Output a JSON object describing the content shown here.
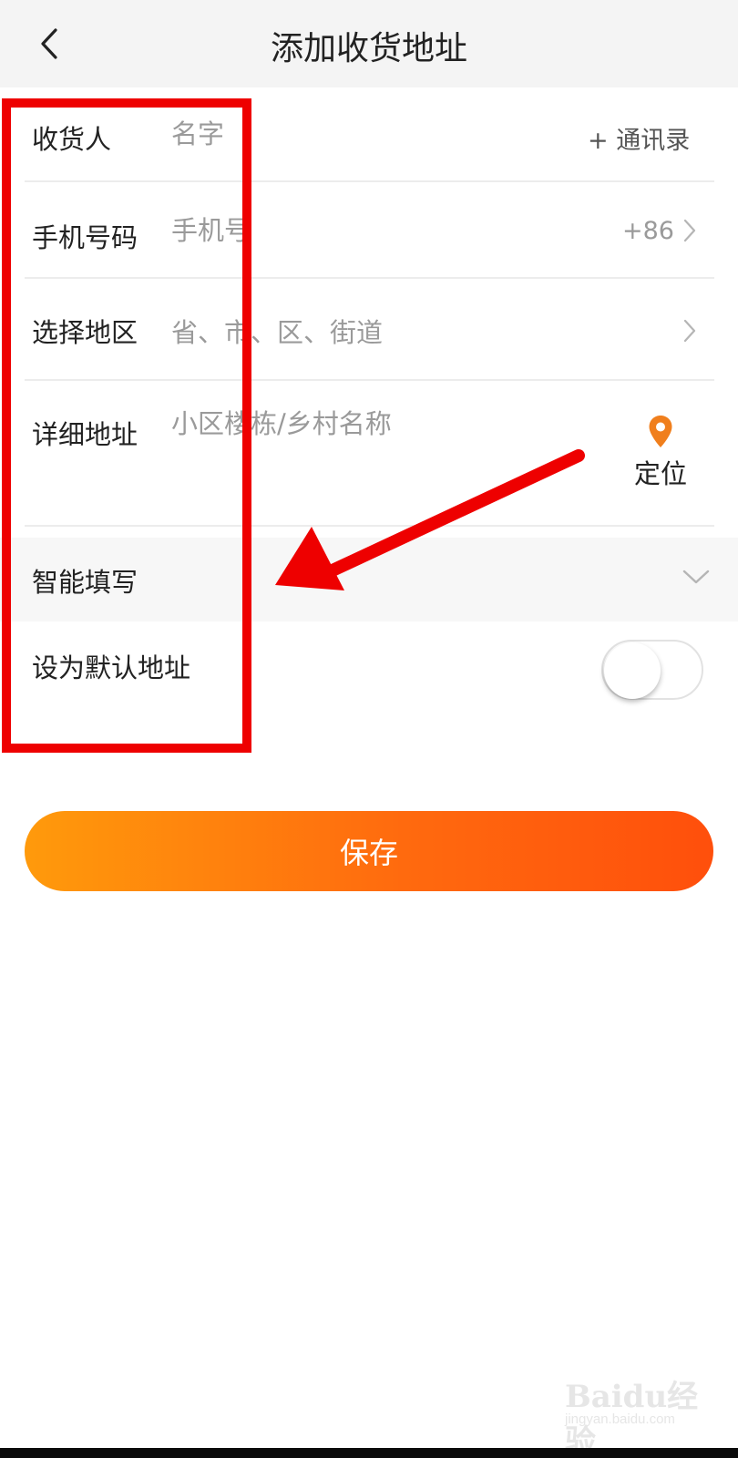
{
  "header": {
    "title": "添加收货地址"
  },
  "form": {
    "recipient": {
      "label": "收货人",
      "placeholder": "名字",
      "contacts_label": "+ 通讯录"
    },
    "phone": {
      "label": "手机号码",
      "placeholder": "手机号",
      "country_code": "+86"
    },
    "region": {
      "label": "选择地区",
      "placeholder": "省、市、区、街道"
    },
    "detail": {
      "label": "详细地址",
      "placeholder": "小区楼栋/乡村名称",
      "locate_label": "定位"
    },
    "smart_fill": {
      "label": "智能填写"
    },
    "default_address": {
      "label": "设为默认地址",
      "enabled": false
    }
  },
  "save_button": {
    "label": "保存"
  },
  "watermark": {
    "brand": "Baidu经验",
    "sub": "jingyan.baidu.com"
  },
  "colors": {
    "accent_start": "#ff9a0c",
    "accent_end": "#ff4f0c",
    "pin": "#f07f1d",
    "annotation_red": "#ee0000"
  }
}
